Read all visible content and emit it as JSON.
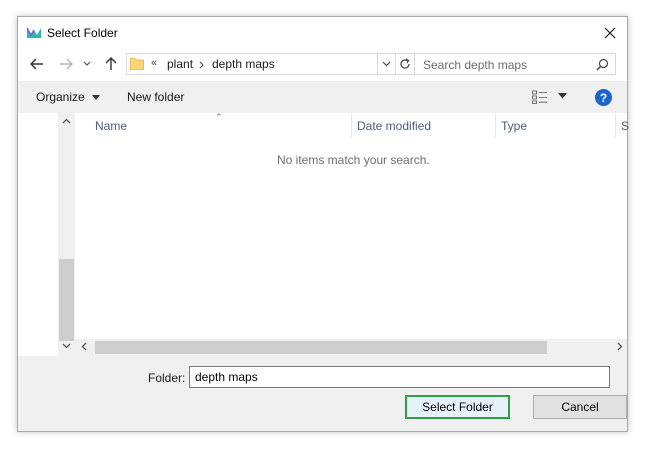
{
  "window": {
    "title": "Select Folder"
  },
  "navigation": {
    "breadcrumb_overflow": "«",
    "breadcrumbs": [
      "plant",
      "depth maps"
    ],
    "search_placeholder": "Search depth maps"
  },
  "toolbar": {
    "organize_label": "Organize",
    "new_folder_label": "New folder"
  },
  "file_list": {
    "columns": [
      "Name",
      "Date modified",
      "Type",
      "S"
    ],
    "empty_message": "No items match your search."
  },
  "footer": {
    "folder_label": "Folder:",
    "folder_value": "depth maps",
    "select_button": "Select Folder",
    "cancel_button": "Cancel"
  },
  "colors": {
    "accent_border": "#2ea043",
    "help_icon": "#1e62cf",
    "column_header_text": "#4c607a"
  }
}
